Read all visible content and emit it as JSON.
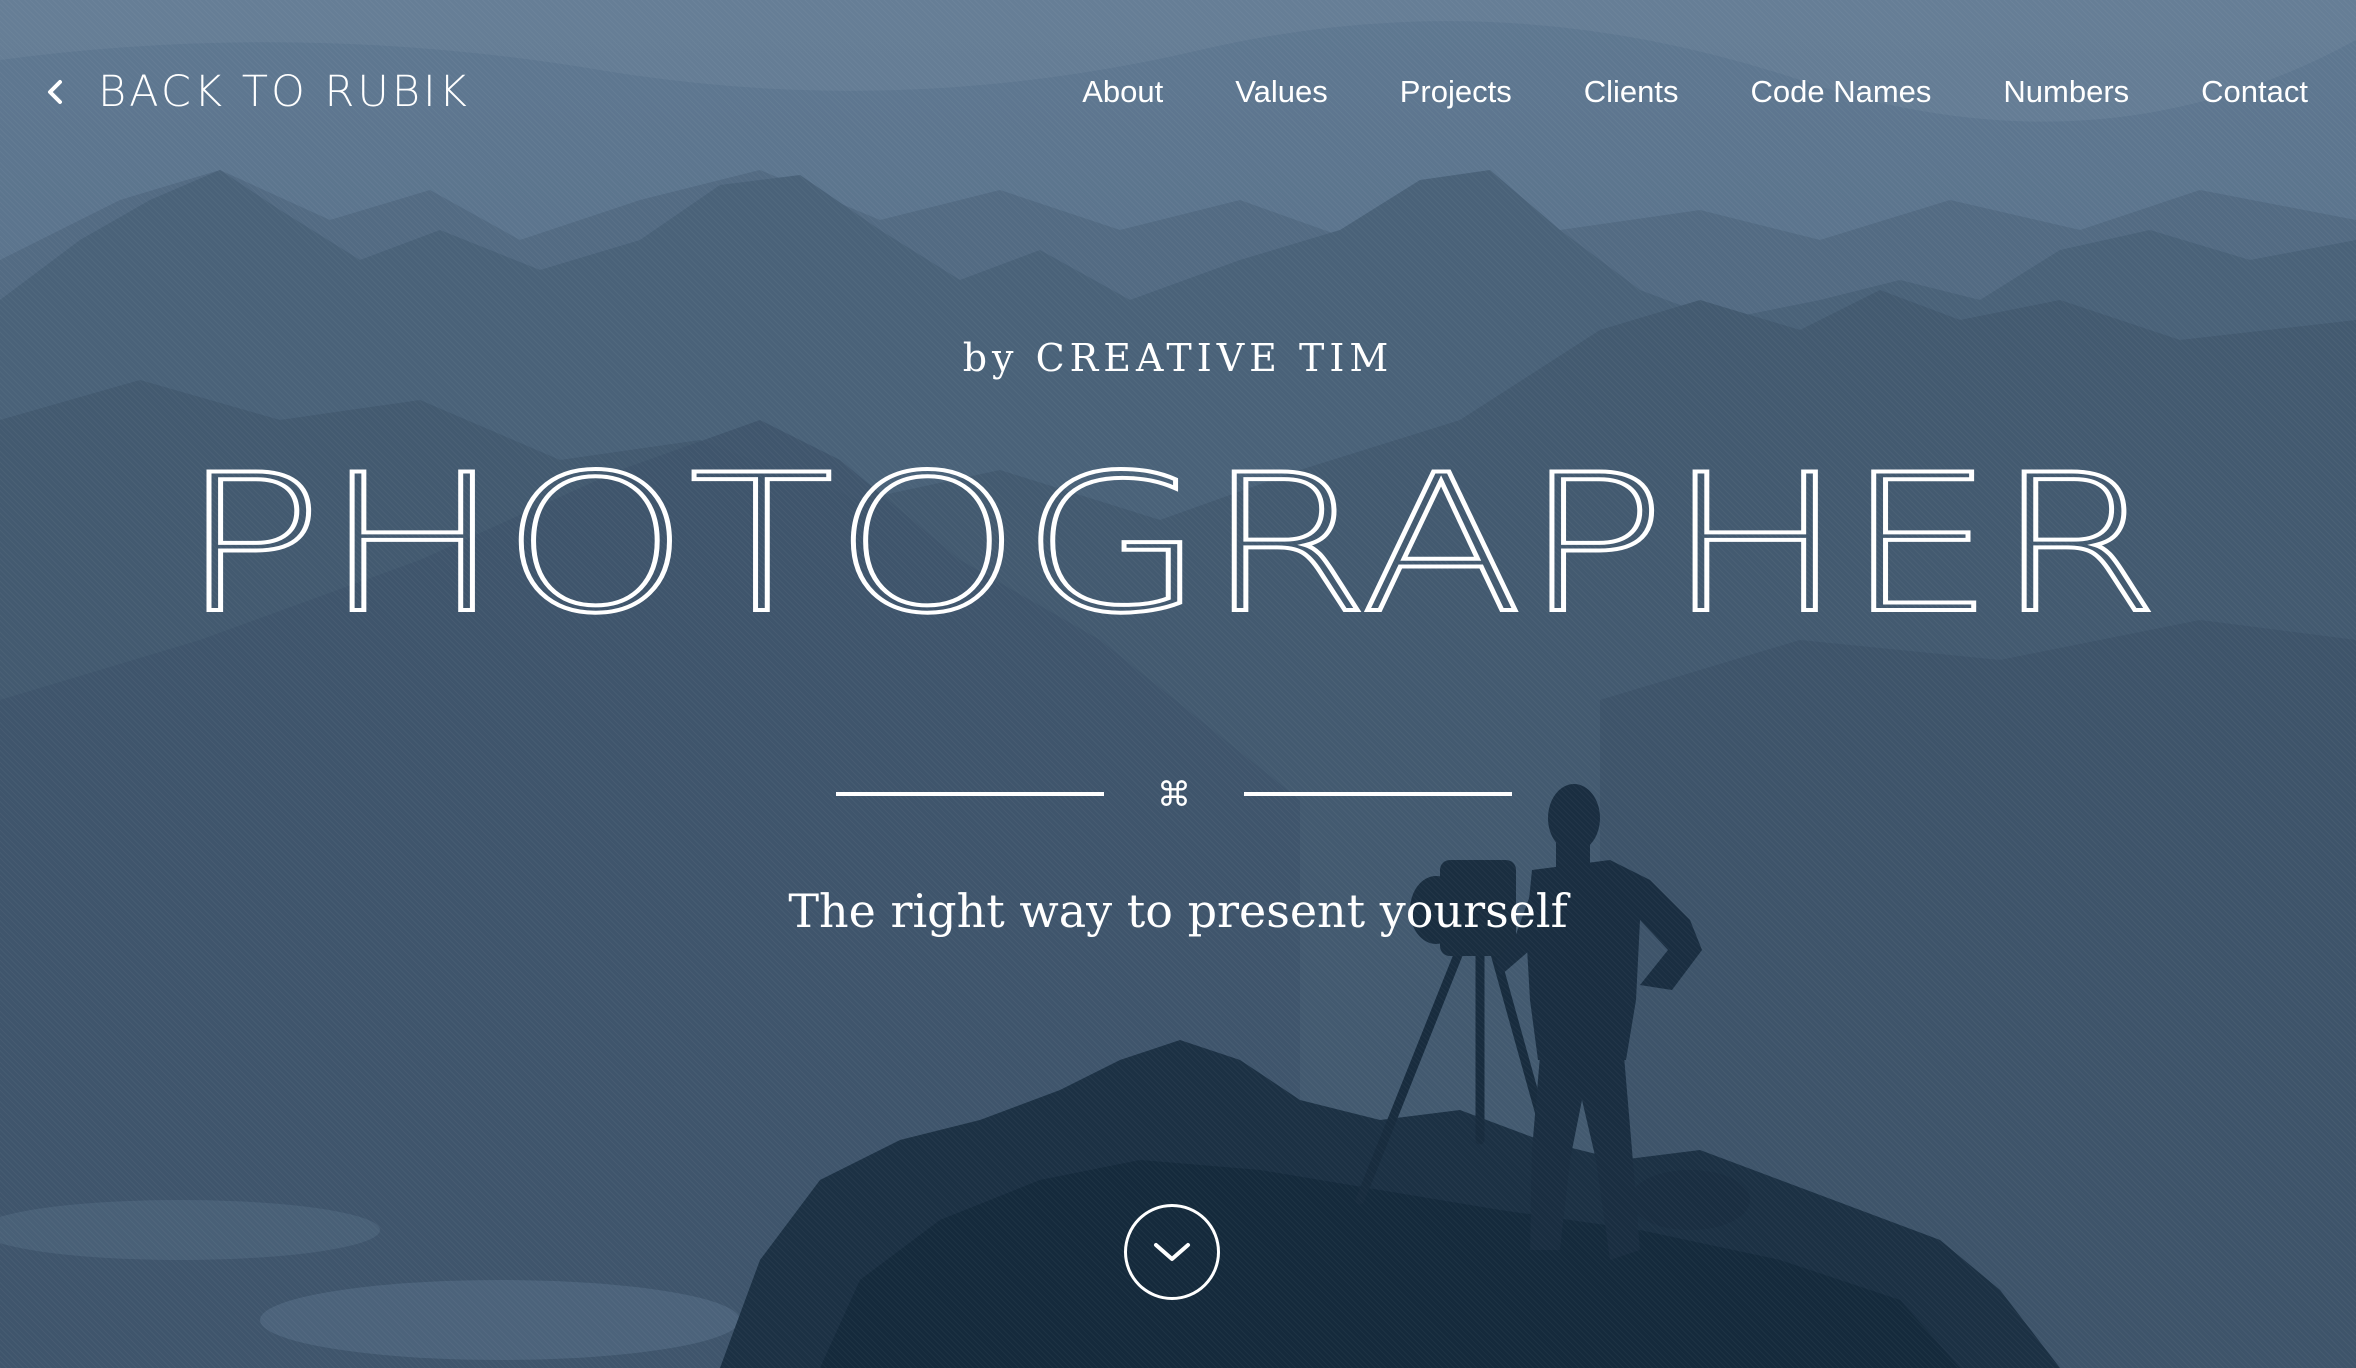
{
  "header": {
    "back_label": "BACK TO RUBIK",
    "nav": [
      "About",
      "Values",
      "Projects",
      "Clients",
      "Code Names",
      "Numbers",
      "Contact"
    ]
  },
  "hero": {
    "byline": "by CREATIVE TIM",
    "title": "PHOTOGRAPHER",
    "divider_symbol": "⌘",
    "tagline": "The right way to present yourself"
  },
  "icons": {
    "back": "chevron-left-icon",
    "scroll": "chevron-down-icon"
  },
  "colors": {
    "overlay": "#3a5268",
    "text": "#ffffff",
    "dark": "#15293c"
  }
}
